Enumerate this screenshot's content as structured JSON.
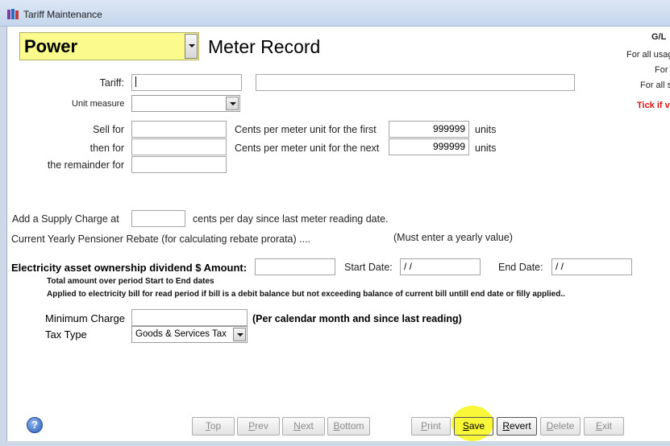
{
  "window": {
    "title": "Tariff Maintenance"
  },
  "header": {
    "utility": "Power",
    "heading": "Meter Record"
  },
  "tariff": {
    "label": "Tariff:",
    "code": "",
    "description": ""
  },
  "unit_measure": {
    "label": "Unit measure",
    "value": ""
  },
  "rates": {
    "sell_for_label": "Sell for",
    "then_for_label": "then for",
    "remainder_label": "the remainder for",
    "first_label": "Cents per meter unit for the first",
    "next_label": "Cents per meter unit for the next",
    "first_units": "999999",
    "next_units": "999999",
    "units_label": "units",
    "sell_for": "",
    "then_for": "",
    "remainder": ""
  },
  "supply": {
    "label": "Add a Supply Charge at",
    "suffix": "cents per day since last meter reading date.",
    "value": ""
  },
  "pensioner": {
    "label": "Current Yearly Pensioner Rebate (for calculating rebate prorata) ....",
    "note": "(Must enter a yearly value)"
  },
  "dividend": {
    "label": "Electricity asset ownership dividend $ Amount:",
    "amount": "",
    "start_label": "Start Date:",
    "start_value": " / /",
    "end_label": "End Date:",
    "end_value": " / /",
    "note1": "Total amount over period Start to End dates",
    "note2": "Applied to electricity bill for read period if bill is a debit balance but not exceeding balance of current bill untill end date or filly applied.."
  },
  "minimum": {
    "label": "Minimum Charge",
    "value": "",
    "note": "(Per calendar month and since last reading)"
  },
  "tax": {
    "label": "Tax Type",
    "value": "Goods & Services Tax"
  },
  "right_panel": {
    "gl": "G/L",
    "line1": "For all usag",
    "line2": "For",
    "line3": "For all s",
    "warn": "Tick if v"
  },
  "buttons": {
    "top": "Top",
    "prev": "Prev",
    "next": "Next",
    "bottom": "Bottom",
    "print": "Print",
    "save": "Save",
    "revert": "Revert",
    "delete": "Delete",
    "exit": "Exit"
  },
  "help": {
    "glyph": "?"
  }
}
